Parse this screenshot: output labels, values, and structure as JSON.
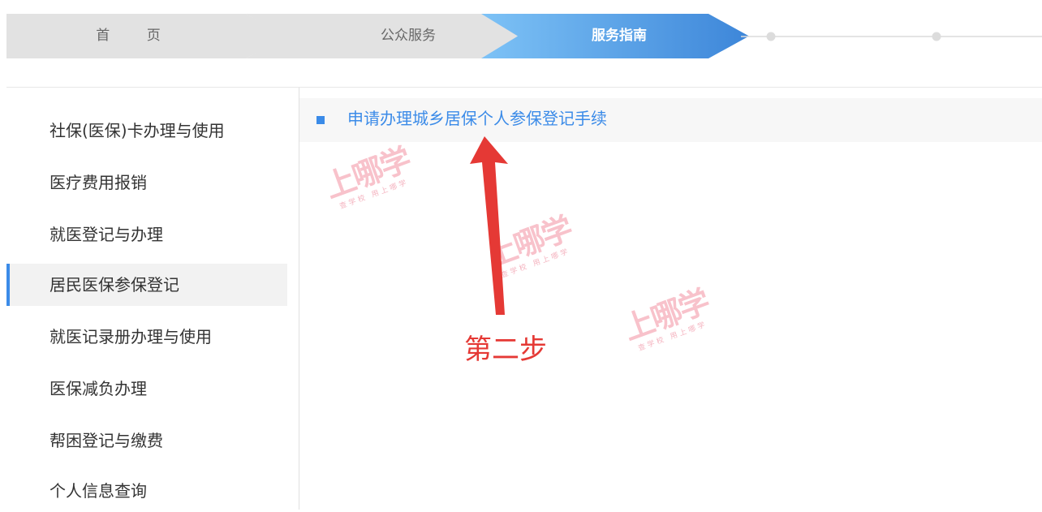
{
  "breadcrumb": {
    "home": "首 页",
    "public_services": "公众服务",
    "service_guide": "服务指南"
  },
  "sidebar": {
    "items": [
      {
        "label": "社保(医保)卡办理与使用"
      },
      {
        "label": "医疗费用报销"
      },
      {
        "label": "就医登记与办理"
      },
      {
        "label": "居民医保参保登记",
        "active": true
      },
      {
        "label": "就医记录册办理与使用"
      },
      {
        "label": "医保减负办理"
      },
      {
        "label": "帮困登记与缴费"
      },
      {
        "label": "个人信息查询"
      }
    ]
  },
  "content": {
    "articles": [
      {
        "title": "申请办理城乡居保个人参保登记手续"
      }
    ]
  },
  "annotation": {
    "label": "第二步"
  },
  "watermark": {
    "logo": "上哪学",
    "tagline": "查学校 用上哪学"
  },
  "colors": {
    "accent": "#3b8be8",
    "crumb_inactive": "#e2e2e2",
    "crumb_active_start": "#7dc2f6",
    "crumb_active_end": "#3d86d9",
    "annotation": "#e53935",
    "watermark": "#f7b8c3"
  }
}
